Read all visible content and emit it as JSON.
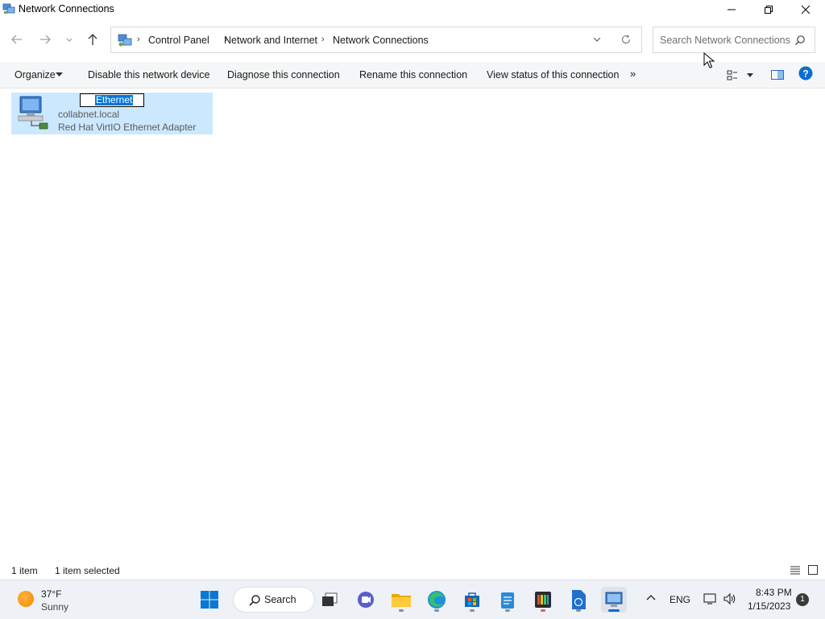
{
  "window": {
    "title": "Network Connections"
  },
  "address": {
    "breadcrumbs": [
      "Control Panel",
      "Network and Internet",
      "Network Connections"
    ],
    "search_placeholder": "Search Network Connections"
  },
  "toolbar": {
    "organize": "Organize",
    "disable": "Disable this network device",
    "diagnose": "Diagnose this connection",
    "rename": "Rename this connection",
    "view_status": "View status of this connection",
    "more": "»"
  },
  "connection": {
    "name": "Ethernet",
    "domain": "collabnet.local",
    "adapter": "Red Hat VirtIO Ethernet Adapter"
  },
  "status": {
    "count": "1 item",
    "selected": "1 item selected"
  },
  "taskbar": {
    "weather_temp": "37°F",
    "weather_condition": "Sunny",
    "search_label": "Search",
    "language": "ENG",
    "time": "8:43 PM",
    "date": "1/15/2023",
    "notification_count": "1"
  },
  "colors": {
    "selection": "#cce8ff",
    "accent": "#0078d7"
  }
}
